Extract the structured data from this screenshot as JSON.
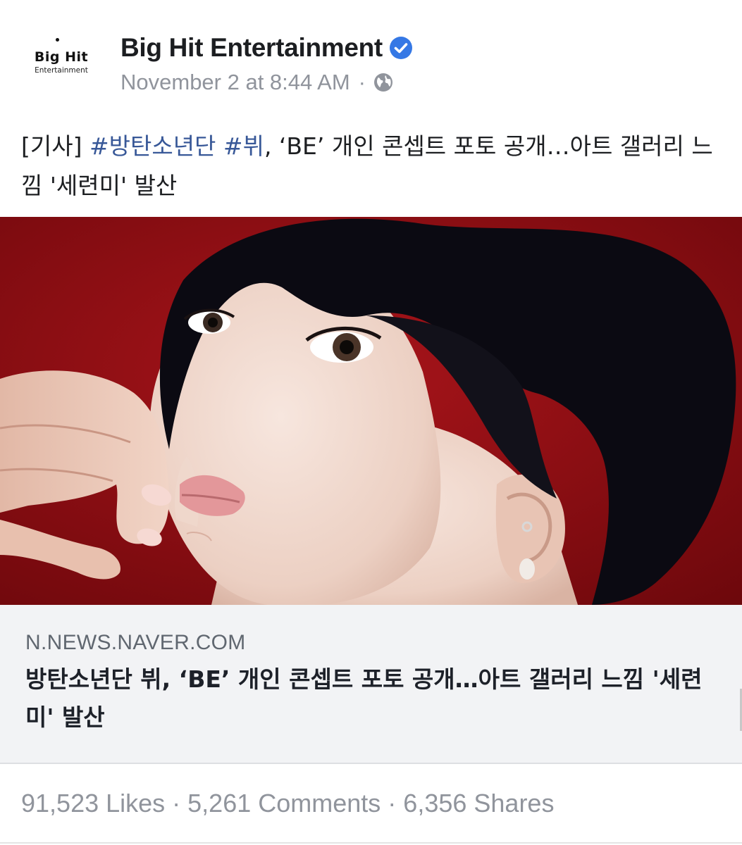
{
  "header": {
    "avatar_logo_main": "Big Hit",
    "avatar_logo_sub": "Entertainment",
    "page_name": "Big Hit Entertainment",
    "timestamp": "November 2 at 8:44 AM",
    "separator": "·",
    "verified_icon": "verified-badge-icon",
    "privacy_icon": "globe-icon"
  },
  "caption": {
    "prefix": "[기사] ",
    "hashtag1": "#방탄소년단",
    "space": " ",
    "hashtag2": "#뷔",
    "body": ", ‘BE’ 개인 콘셉트 포토 공개…아트 갤러리 느낌 '세련미' 발산"
  },
  "link_preview": {
    "domain": "N.NEWS.NAVER.COM",
    "title": "방탄소년단 뷔, ‘BE’ 개인 콘셉트 포토 공개…아트 갤러리 느낌 '세련미' 발산"
  },
  "stats": {
    "likes": "91,523 Likes",
    "comments": "5,261 Comments",
    "shares": "6,356 Shares",
    "separator": "·"
  },
  "colors": {
    "page_name": "#1c1e21",
    "meta": "#90949c",
    "hashtag": "#385898",
    "verified": "#3578e5",
    "link_bg": "#f2f3f5",
    "photo_bg": "#8a0d12"
  }
}
